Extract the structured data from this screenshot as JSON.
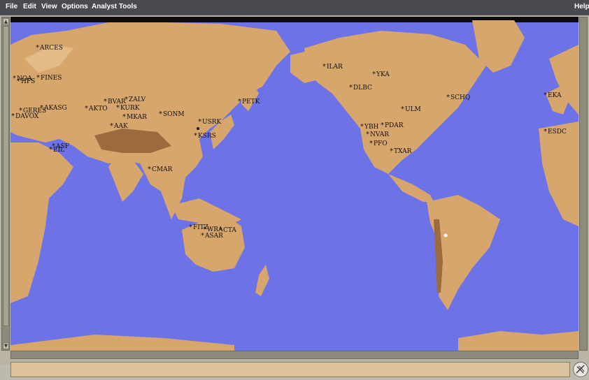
{
  "menu": {
    "file": "File",
    "edit": "Edit",
    "view": "View",
    "options": "Options",
    "analyst_tools": "Analyst Tools",
    "help": "Help"
  },
  "status": {
    "text": ""
  },
  "icons": {
    "station_marker": "asterisk-icon",
    "status": "satellite-dish-icon"
  },
  "colors": {
    "ocean": "#6d72e6",
    "land": "#d7a66c",
    "status_bar": "#dcc29c"
  },
  "stations": [
    {
      "label": "ARCES"
    },
    {
      "label": "NOA"
    },
    {
      "label": "HFS"
    },
    {
      "label": "FINES"
    },
    {
      "label": "AKASG"
    },
    {
      "label": "GERES"
    },
    {
      "label": "DAVOX"
    },
    {
      "label": "BVAR"
    },
    {
      "label": "ZALV"
    },
    {
      "label": "AKTO"
    },
    {
      "label": "KURK"
    },
    {
      "label": "MKAR"
    },
    {
      "label": "SONM"
    },
    {
      "label": "AAK"
    },
    {
      "label": "USRK"
    },
    {
      "label": "KSRS"
    },
    {
      "label": "ASF"
    },
    {
      "label": "EIL"
    },
    {
      "label": "CMAR"
    },
    {
      "label": "PETK"
    },
    {
      "label": "ILAR"
    },
    {
      "label": "YKA"
    },
    {
      "label": "DLBC"
    },
    {
      "label": "SCHQ"
    },
    {
      "label": "ULM"
    },
    {
      "label": "YBH"
    },
    {
      "label": "PDAR"
    },
    {
      "label": "NVAR"
    },
    {
      "label": "PFO"
    },
    {
      "label": "TXAR"
    },
    {
      "label": "EKA"
    },
    {
      "label": "ESDC"
    },
    {
      "label": "FITZ"
    },
    {
      "label": "WRA"
    },
    {
      "label": "CTA"
    },
    {
      "label": "ASAR"
    }
  ]
}
